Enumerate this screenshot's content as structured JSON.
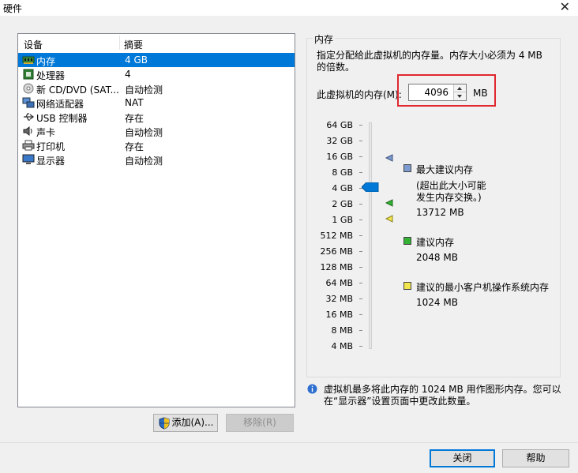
{
  "window": {
    "title": "硬件"
  },
  "device_list": {
    "headers": {
      "device": "设备",
      "summary": "摘要"
    },
    "rows": [
      {
        "icon": "memory-icon",
        "name": "内存",
        "summary": "4 GB",
        "selected": true
      },
      {
        "icon": "processor-icon",
        "name": "处理器",
        "summary": "4"
      },
      {
        "icon": "cd-dvd-icon",
        "name": "新 CD/DVD (SAT...",
        "summary": "自动检测"
      },
      {
        "icon": "network-adapter-icon",
        "name": "网络适配器",
        "summary": "NAT"
      },
      {
        "icon": "usb-icon",
        "name": "USB 控制器",
        "summary": "存在"
      },
      {
        "icon": "sound-card-icon",
        "name": "声卡",
        "summary": "自动检测"
      },
      {
        "icon": "printer-icon",
        "name": "打印机",
        "summary": "存在"
      },
      {
        "icon": "display-icon",
        "name": "显示器",
        "summary": "自动检测"
      }
    ]
  },
  "buttons": {
    "add": "添加(A)...",
    "remove": "移除(R)",
    "close": "关闭",
    "help": "帮助"
  },
  "memory": {
    "group_label": "内存",
    "description": "指定分配给此虚拟机的内存量。内存大小必须为 4 MB 的倍数。",
    "field_label": "此虚拟机的内存(M):",
    "value": "4096",
    "unit": "MB",
    "scale_labels": [
      "64 GB",
      "32 GB",
      "16 GB",
      "8 GB",
      "4 GB",
      "2 GB",
      "1 GB",
      "512 MB",
      "256 MB",
      "128 MB",
      "64 MB",
      "32 MB",
      "16 MB",
      "8 MB",
      "4 MB"
    ],
    "legend": {
      "max": {
        "label": "最大建议内存",
        "note1": "(超出此大小可能",
        "note2": "发生内存交换。)",
        "value": "13712 MB",
        "color": "#7b9bd1"
      },
      "recommended": {
        "label": "建议内存",
        "value": "2048 MB",
        "color": "#33b233"
      },
      "min_guest": {
        "label": "建议的最小客户机操作系统内存",
        "value": "1024 MB",
        "color": "#f2e64d"
      }
    },
    "info": "虚拟机最多将此内存的 1024 MB 用作图形内存。您可以在“显示器”设置页面中更改此数量。"
  },
  "colors": {
    "accent": "#0078d7",
    "highlight": "#e0272e"
  }
}
